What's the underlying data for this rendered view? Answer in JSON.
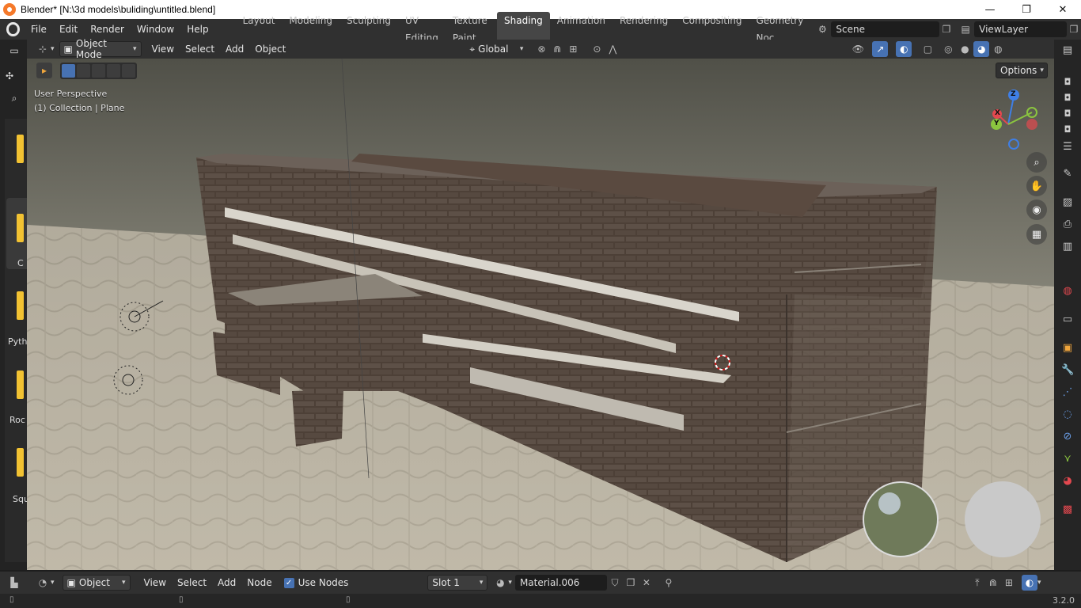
{
  "window": {
    "title": "Blender* [N:\\3d models\\buliding\\untitled.blend]",
    "minimize": "—",
    "maximize": "❐",
    "close": "✕"
  },
  "topmenu": {
    "items": [
      "File",
      "Edit",
      "Render",
      "Window",
      "Help"
    ],
    "workspaces": [
      "Layout",
      "Modeling",
      "Sculpting",
      "UV Editing",
      "Texture Paint",
      "Shading",
      "Animation",
      "Rendering",
      "Compositing",
      "Geometry Noc"
    ],
    "active_workspace": "Shading",
    "scene": "Scene",
    "view_layer": "ViewLayer"
  },
  "view_header": {
    "mode": "Object Mode",
    "menus": [
      "View",
      "Select",
      "Add",
      "Object"
    ],
    "orientation": "Global",
    "options": "Options"
  },
  "viewport": {
    "perspective": "User Perspective",
    "collection": "(1) Collection | Plane"
  },
  "left_panel_labels": [
    "C",
    "Pyth",
    "Roc",
    "Squ"
  ],
  "gizmo": {
    "x": "X",
    "y": "Y",
    "z": "Z"
  },
  "bottom_header": {
    "editor_type": "Object",
    "menus": [
      "View",
      "Select",
      "Add",
      "Node"
    ],
    "use_nodes_label": "Use Nodes",
    "use_nodes": true,
    "slot": "Slot 1",
    "material": "Material.006"
  },
  "status": {
    "version": "3.2.0"
  },
  "colors": {
    "accent": "#4772b3",
    "gizmo_x": "#e3484f",
    "gizmo_y": "#8bc53f",
    "gizmo_z": "#3f7fe6"
  },
  "icons": [
    "blender-logo-icon",
    "editor-type-icon",
    "magnet-icon",
    "proportional-icon",
    "overlay-icon",
    "xray-icon",
    "shading-solid-icon",
    "zoom-icon",
    "hand-icon",
    "camera-icon",
    "grid-icon"
  ]
}
